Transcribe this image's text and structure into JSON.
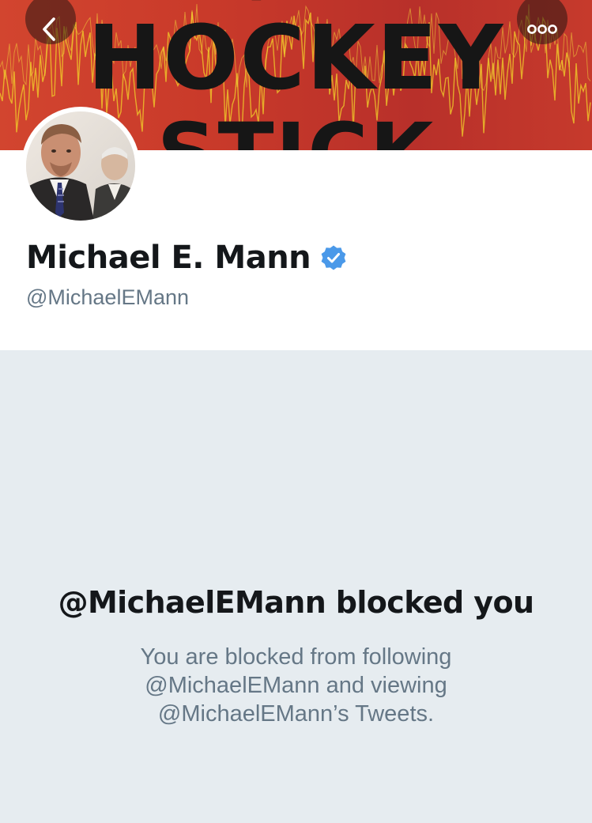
{
  "banner": {
    "title_top": "THE",
    "title_main": "HOCKEY",
    "title_bottom": "STICK",
    "colors": {
      "background": "#c63a2c",
      "wave": "#f2d22a",
      "text": "#161616"
    }
  },
  "nav": {
    "back_icon": "chevron-left-icon",
    "more_icon": "more-horizontal-icon"
  },
  "profile": {
    "display_name": "Michael E. Mann",
    "verified": true,
    "verified_icon": "verified-badge-icon",
    "verified_color": "#4a99e9",
    "handle": "@MichaelEMann"
  },
  "blocked": {
    "title": "@MichaelEMann blocked you",
    "description_lines": [
      "You are blocked from following",
      "@MichaelEMann and viewing",
      "@MichaelEMann’s Tweets."
    ]
  },
  "colors": {
    "panel_background": "#e6ecf0",
    "primary_text": "#14171a",
    "secondary_text": "#657786"
  }
}
